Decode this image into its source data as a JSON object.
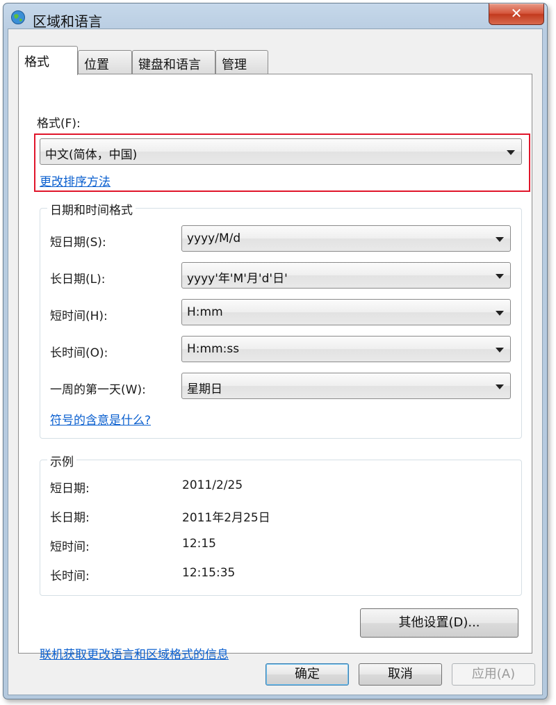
{
  "window": {
    "title": "区域和语言",
    "close_glyph": "✕"
  },
  "tabs": [
    {
      "label": "格式"
    },
    {
      "label": "位置"
    },
    {
      "label": "键盘和语言"
    },
    {
      "label": "管理"
    }
  ],
  "format": {
    "label": "格式(F):",
    "selected": "中文(简体，中国)",
    "sort_link": "更改排序方法"
  },
  "datetime_group": {
    "title": "日期和时间格式",
    "rows": [
      {
        "label": "短日期(S):",
        "value": "yyyy/M/d"
      },
      {
        "label": "长日期(L):",
        "value": "yyyy'年'M'月'd'日'"
      },
      {
        "label": "短时间(H):",
        "value": "H:mm"
      },
      {
        "label": "长时间(O):",
        "value": "H:mm:ss"
      },
      {
        "label": "一周的第一天(W):",
        "value": "星期日"
      }
    ],
    "symbol_link": "符号的含意是什么?"
  },
  "example_group": {
    "title": "示例",
    "rows": [
      {
        "label": "短日期:",
        "value": "2011/2/25"
      },
      {
        "label": "长日期:",
        "value": "2011年2月25日"
      },
      {
        "label": "短时间:",
        "value": "12:15"
      },
      {
        "label": "长时间:",
        "value": "12:15:35"
      }
    ]
  },
  "other_settings_button": "其他设置(D)...",
  "online_link": "联机获取更改语言和区域格式的信息",
  "buttons": {
    "ok": "确定",
    "cancel": "取消",
    "apply": "应用(A)"
  },
  "icons": {
    "title": "globe-icon",
    "combo": "dropdown-arrow-icon"
  },
  "colors": {
    "highlight": "#e0152a",
    "link": "#0a5fcf",
    "title_bar": "#b9cde2"
  }
}
